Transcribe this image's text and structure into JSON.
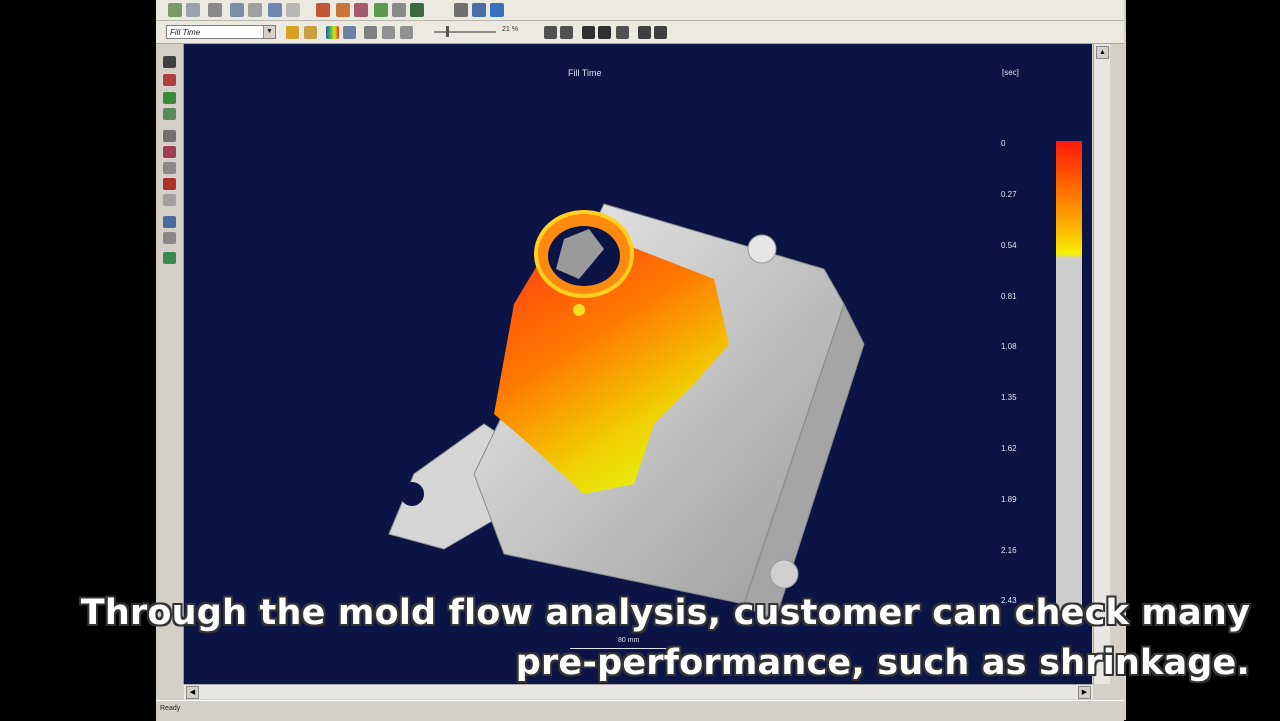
{
  "toolbar": {
    "result_selector_value": "Fill Time",
    "zoom_value": "21 %"
  },
  "viewport": {
    "plot_title": "Fill Time",
    "unit": "[sec]",
    "scale_label": "80 mm"
  },
  "legend": {
    "ticks": [
      "0",
      "0.27",
      "0.54",
      "0.81",
      "1.08",
      "1.35",
      "1.62",
      "1.89",
      "2.16",
      "2.43"
    ]
  },
  "status": {
    "text": "Ready"
  },
  "caption": {
    "line1": "Through the mold flow analysis, customer can check many",
    "line2": "pre-performance, such as shrinkage."
  },
  "colors": {
    "viewport_bg": "#0b1445",
    "fill_red": "#ff2a0a",
    "fill_yellow": "#f5f000",
    "unfilled_gray": "#cdcdcd"
  }
}
